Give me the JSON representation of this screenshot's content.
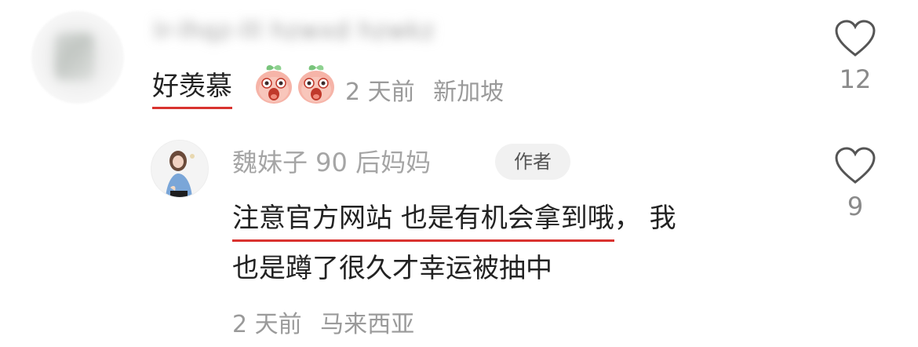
{
  "comment": {
    "username": "lr-lhqz-lll hzwxd hzwkz",
    "text": "好羡慕",
    "emojis": [
      "peach-face-emoji",
      "peach-face-emoji"
    ],
    "time": "2 天前",
    "location": "新加坡",
    "likes": "12"
  },
  "reply": {
    "name": "魏妹子 90 后妈妈",
    "badge": "作者",
    "line1_highlight": "注意官方网站 也是有机会拿到哦",
    "line1_rest": "， 我",
    "line2": "也是蹲了很久才幸运被抽中",
    "time": "2 天前",
    "location": "马来西亚",
    "likes": "9"
  },
  "colors": {
    "underline": "#d9332f",
    "meta_text": "#9a9a9a",
    "badge_bg": "#f1f1f1",
    "main_text": "#222222"
  }
}
